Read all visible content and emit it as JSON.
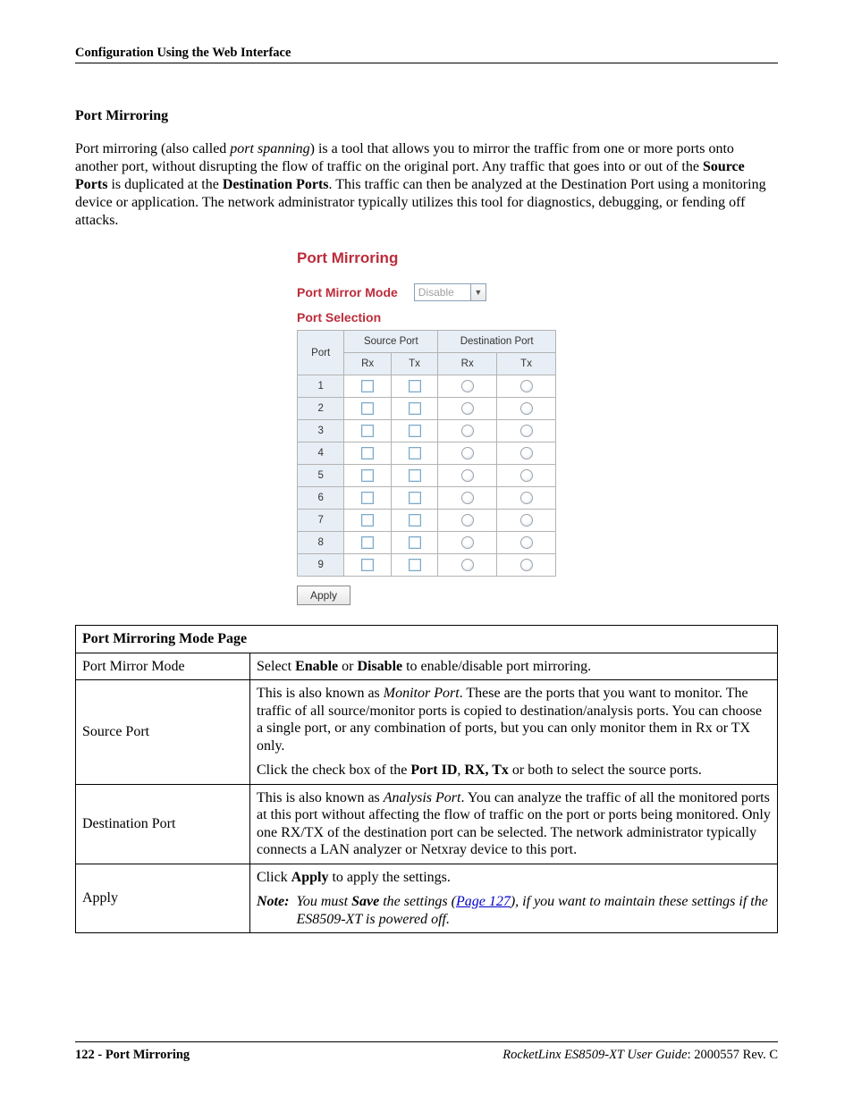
{
  "header": {
    "text": "Configuration Using the Web Interface"
  },
  "section": {
    "heading": "Port Mirroring",
    "para": {
      "pre1": "Port mirroring (also called ",
      "ital1": "port spanning",
      "mid1": ") is a tool that allows you to mirror the traffic from one or more ports onto another port, without disrupting the flow of traffic on the original port. Any traffic that goes into or out of the ",
      "b1": "Source Ports",
      "mid2": " is duplicated at the ",
      "b2": "Destination Ports",
      "post": ". This traffic can then be analyzed at the Destination Port using a monitoring device or application. The network administrator typically utilizes this tool for diagnostics, debugging, or fending off attacks."
    }
  },
  "figure": {
    "title": "Port Mirroring",
    "mode_label": "Port Mirror Mode",
    "mode_value": "Disable",
    "selection_label": "Port Selection",
    "table": {
      "h_port": "Port",
      "h_src": "Source Port",
      "h_dst": "Destination Port",
      "h_rx": "Rx",
      "h_tx": "Tx",
      "ports": [
        "1",
        "2",
        "3",
        "4",
        "5",
        "6",
        "7",
        "8",
        "9"
      ]
    },
    "apply": "Apply"
  },
  "desc": {
    "title": "Port Mirroring Mode Page",
    "rows": {
      "r1": {
        "label": "Port Mirror Mode",
        "pre": "Select ",
        "b1": "Enable",
        "mid": " or ",
        "b2": "Disable",
        "post": " to enable/disable port mirroring."
      },
      "r2": {
        "label": "Source Port",
        "p1_pre": "This is also known as ",
        "p1_ital": "Monitor Port",
        "p1_post": ". These are the ports that you want to monitor. The traffic of all source/monitor ports is copied to destination/analysis ports. You can choose a single port, or any combination of ports, but you can only monitor them in Rx or TX only.",
        "p2_pre": "Click the check box of the ",
        "p2_b1": "Port ID",
        "p2_sep1": ", ",
        "p2_b2": "RX, Tx",
        "p2_post": " or both to select the source ports."
      },
      "r3": {
        "label": "Destination Port",
        "p_pre": "This is also known as ",
        "p_ital": "Analysis Port",
        "p_post": ". You can analyze the traffic of all the monitored ports at this port without affecting the flow of traffic on the port or ports being monitored. Only one RX/TX of the destination port can be selected. The network administrator typically connects a LAN analyzer or Netxray device to this port."
      },
      "r4": {
        "label": "Apply",
        "p1_pre": "Click ",
        "p1_b": "Apply",
        "p1_post": " to apply the settings.",
        "note_key": "Note:",
        "note_pre": "You must ",
        "note_b": "Save",
        "note_mid": " the settings (",
        "note_link": "Page 127",
        "note_post1": "), if you want to maintain these settings if the ES8509-XT is powered off."
      }
    }
  },
  "footer": {
    "left": "122 - Port Mirroring",
    "right_ital": "RocketLinx ES8509-XT User Guide",
    "right_rest": ": 2000557 Rev. C"
  }
}
